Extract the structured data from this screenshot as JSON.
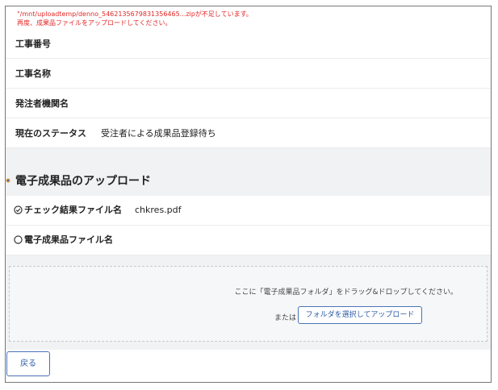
{
  "errors": {
    "line1": "\"/mnt/uploadtemp/denno_5462135679831356465...zipが不足しています。",
    "line2": "再度、成果品ファイルをアップロードしてください。"
  },
  "info_rows": [
    {
      "label": "工事番号",
      "value": ""
    },
    {
      "label": "工事名称",
      "value": ""
    },
    {
      "label": "発注者機関名",
      "value": ""
    },
    {
      "label": "現在のステータス",
      "value": "受注者による成果品登録待ち"
    }
  ],
  "upload_section": {
    "title": "電子成果品のアップロード",
    "check_file": {
      "label": "チェック結果ファイル名",
      "value": "chkres.pdf",
      "icon": "check-circle-icon"
    },
    "product_file": {
      "label": "電子成果品ファイル名",
      "value": "",
      "icon": "empty-circle-icon"
    },
    "dropzone_text": "ここに「電子成果品フォルダ」をドラッグ&ドロップしてください。",
    "or_text": "または",
    "select_button": "フォルダを選択してアップロード"
  },
  "back_button": "戻る",
  "colors": {
    "error": "#e32626",
    "accent": "#2c5ba8",
    "band": "#f1f2f4"
  }
}
